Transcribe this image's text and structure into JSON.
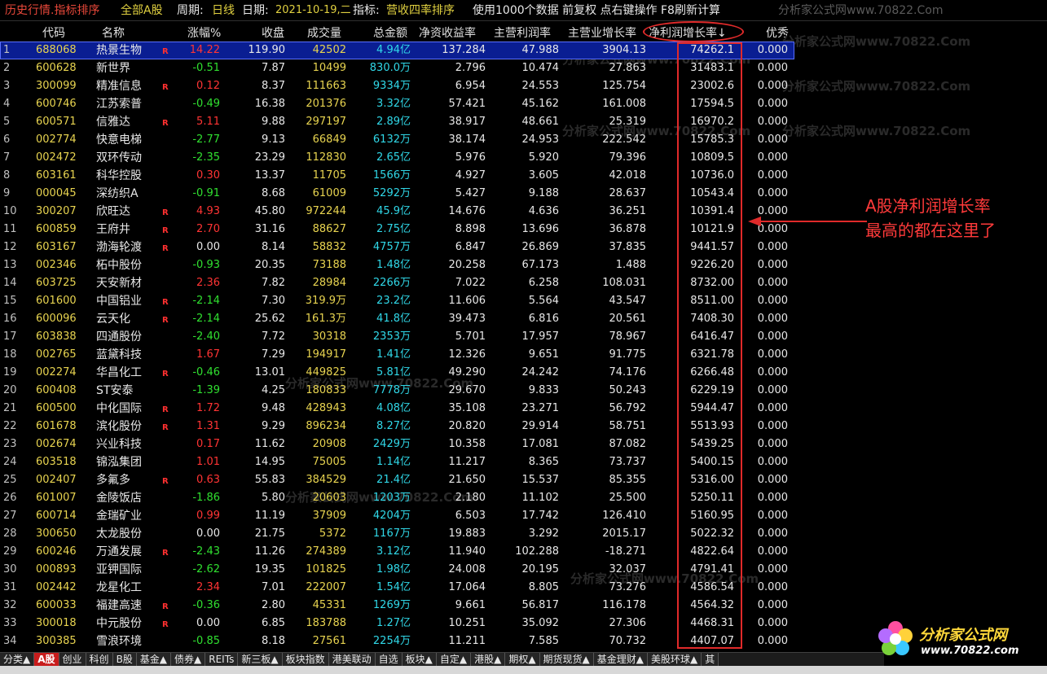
{
  "topbar": {
    "title": "历史行情.指标排序",
    "market": "全部A股",
    "period_label": "周期:",
    "period_value": "日线",
    "date_label": "日期:",
    "date_value": "2021-10-19,二",
    "indicator_label": "指标:",
    "indicator_value": "营收四率排序",
    "info": "使用1000个数据 前复权 点右键操作 F8刷新计算",
    "watermark": "分析家公式网www.70822.Com"
  },
  "columns": [
    "代码",
    "名称",
    "涨幅%",
    "收盘",
    "成交量",
    "总金额",
    "净资收益率",
    "主营利润率",
    "主营业增长率",
    "净利润增长率↓",
    "优秀"
  ],
  "rows": [
    {
      "idx": "1",
      "code": "688068",
      "name": "热景生物",
      "r": "R",
      "pct": "14.22",
      "dir": "up",
      "close": "119.90",
      "vol": "42502",
      "amt": "4.94亿",
      "roe": "137.284",
      "npm": "47.988",
      "rev": "3904.13",
      "npg": "74262.1",
      "exc": "0.000"
    },
    {
      "idx": "2",
      "code": "600628",
      "name": "新世界",
      "r": "",
      "pct": "-0.51",
      "dir": "down",
      "close": "7.87",
      "vol": "10499",
      "amt": "830.0万",
      "roe": "2.796",
      "npm": "10.474",
      "rev": "27.863",
      "npg": "31483.1",
      "exc": "0.000"
    },
    {
      "idx": "3",
      "code": "300099",
      "name": "精准信息",
      "r": "R",
      "pct": "0.12",
      "dir": "up",
      "close": "8.37",
      "vol": "111663",
      "amt": "9334万",
      "roe": "6.954",
      "npm": "24.553",
      "rev": "125.754",
      "npg": "23002.6",
      "exc": "0.000"
    },
    {
      "idx": "4",
      "code": "600746",
      "name": "江苏索普",
      "r": "",
      "pct": "-0.49",
      "dir": "down",
      "close": "16.38",
      "vol": "201376",
      "amt": "3.32亿",
      "roe": "57.421",
      "npm": "45.162",
      "rev": "161.008",
      "npg": "17594.5",
      "exc": "0.000"
    },
    {
      "idx": "5",
      "code": "600571",
      "name": "信雅达",
      "r": "R",
      "pct": "5.11",
      "dir": "up",
      "close": "9.88",
      "vol": "297197",
      "amt": "2.89亿",
      "roe": "38.917",
      "npm": "48.661",
      "rev": "25.319",
      "npg": "16970.2",
      "exc": "0.000"
    },
    {
      "idx": "6",
      "code": "002774",
      "name": "快意电梯",
      "r": "",
      "pct": "-2.77",
      "dir": "down",
      "close": "9.13",
      "vol": "66849",
      "amt": "6132万",
      "roe": "38.174",
      "npm": "24.953",
      "rev": "222.542",
      "npg": "15785.3",
      "exc": "0.000"
    },
    {
      "idx": "7",
      "code": "002472",
      "name": "双环传动",
      "r": "",
      "pct": "-2.35",
      "dir": "down",
      "close": "23.29",
      "vol": "112830",
      "amt": "2.65亿",
      "roe": "5.976",
      "npm": "5.920",
      "rev": "79.396",
      "npg": "10809.5",
      "exc": "0.000"
    },
    {
      "idx": "8",
      "code": "603161",
      "name": "科华控股",
      "r": "",
      "pct": "0.30",
      "dir": "up",
      "close": "13.37",
      "vol": "11705",
      "amt": "1566万",
      "roe": "4.927",
      "npm": "3.605",
      "rev": "42.018",
      "npg": "10736.0",
      "exc": "0.000"
    },
    {
      "idx": "9",
      "code": "000045",
      "name": "深纺织A",
      "r": "",
      "pct": "-0.91",
      "dir": "down",
      "close": "8.68",
      "vol": "61009",
      "amt": "5292万",
      "roe": "5.427",
      "npm": "9.188",
      "rev": "28.637",
      "npg": "10543.4",
      "exc": "0.000"
    },
    {
      "idx": "10",
      "code": "300207",
      "name": "欣旺达",
      "r": "R",
      "pct": "4.93",
      "dir": "up",
      "close": "45.80",
      "vol": "972244",
      "amt": "45.9亿",
      "roe": "14.676",
      "npm": "4.636",
      "rev": "36.251",
      "npg": "10391.4",
      "exc": "0.000"
    },
    {
      "idx": "11",
      "code": "600859",
      "name": "王府井",
      "r": "R",
      "pct": "2.70",
      "dir": "up",
      "close": "31.16",
      "vol": "88627",
      "amt": "2.75亿",
      "roe": "8.898",
      "npm": "13.696",
      "rev": "36.878",
      "npg": "10121.9",
      "exc": "0.000"
    },
    {
      "idx": "12",
      "code": "603167",
      "name": "渤海轮渡",
      "r": "R",
      "pct": "0.00",
      "dir": "flat",
      "close": "8.14",
      "vol": "58832",
      "amt": "4757万",
      "roe": "6.847",
      "npm": "26.869",
      "rev": "37.835",
      "npg": "9441.57",
      "exc": "0.000"
    },
    {
      "idx": "13",
      "code": "002346",
      "name": "柘中股份",
      "r": "",
      "pct": "-0.93",
      "dir": "down",
      "close": "20.35",
      "vol": "73188",
      "amt": "1.48亿",
      "roe": "20.258",
      "npm": "67.173",
      "rev": "1.488",
      "npg": "9226.20",
      "exc": "0.000"
    },
    {
      "idx": "14",
      "code": "603725",
      "name": "天安新材",
      "r": "",
      "pct": "2.36",
      "dir": "up",
      "close": "7.82",
      "vol": "28984",
      "amt": "2266万",
      "roe": "7.022",
      "npm": "6.258",
      "rev": "108.031",
      "npg": "8732.00",
      "exc": "0.000"
    },
    {
      "idx": "15",
      "code": "601600",
      "name": "中国铝业",
      "r": "R",
      "pct": "-2.14",
      "dir": "down",
      "close": "7.30",
      "vol": "319.9万",
      "amt": "23.2亿",
      "roe": "11.606",
      "npm": "5.564",
      "rev": "43.547",
      "npg": "8511.00",
      "exc": "0.000"
    },
    {
      "idx": "16",
      "code": "600096",
      "name": "云天化",
      "r": "R",
      "pct": "-2.14",
      "dir": "down",
      "close": "25.62",
      "vol": "161.3万",
      "amt": "41.8亿",
      "roe": "39.473",
      "npm": "6.816",
      "rev": "20.561",
      "npg": "7408.30",
      "exc": "0.000"
    },
    {
      "idx": "17",
      "code": "603838",
      "name": "四通股份",
      "r": "",
      "pct": "-2.40",
      "dir": "down",
      "close": "7.72",
      "vol": "30318",
      "amt": "2353万",
      "roe": "5.701",
      "npm": "17.957",
      "rev": "78.967",
      "npg": "6416.47",
      "exc": "0.000"
    },
    {
      "idx": "18",
      "code": "002765",
      "name": "蓝黛科技",
      "r": "",
      "pct": "1.67",
      "dir": "up",
      "close": "7.29",
      "vol": "194917",
      "amt": "1.41亿",
      "roe": "12.326",
      "npm": "9.651",
      "rev": "91.775",
      "npg": "6321.78",
      "exc": "0.000"
    },
    {
      "idx": "19",
      "code": "002274",
      "name": "华昌化工",
      "r": "R",
      "pct": "-0.46",
      "dir": "down",
      "close": "13.01",
      "vol": "449825",
      "amt": "5.81亿",
      "roe": "49.290",
      "npm": "24.242",
      "rev": "74.176",
      "npg": "6266.48",
      "exc": "0.000"
    },
    {
      "idx": "20",
      "code": "600408",
      "name": "ST安泰",
      "r": "",
      "pct": "-1.39",
      "dir": "down",
      "close": "4.25",
      "vol": "180833",
      "amt": "7778万",
      "roe": "29.670",
      "npm": "9.833",
      "rev": "50.243",
      "npg": "6229.19",
      "exc": "0.000"
    },
    {
      "idx": "21",
      "code": "600500",
      "name": "中化国际",
      "r": "R",
      "pct": "1.72",
      "dir": "up",
      "close": "9.48",
      "vol": "428943",
      "amt": "4.08亿",
      "roe": "35.108",
      "npm": "23.271",
      "rev": "56.792",
      "npg": "5944.47",
      "exc": "0.000"
    },
    {
      "idx": "22",
      "code": "601678",
      "name": "滨化股份",
      "r": "R",
      "pct": "1.31",
      "dir": "up",
      "close": "9.29",
      "vol": "896234",
      "amt": "8.27亿",
      "roe": "20.820",
      "npm": "29.914",
      "rev": "58.751",
      "npg": "5513.93",
      "exc": "0.000"
    },
    {
      "idx": "23",
      "code": "002674",
      "name": "兴业科技",
      "r": "",
      "pct": "0.17",
      "dir": "up",
      "close": "11.62",
      "vol": "20908",
      "amt": "2429万",
      "roe": "10.358",
      "npm": "17.081",
      "rev": "87.082",
      "npg": "5439.25",
      "exc": "0.000"
    },
    {
      "idx": "24",
      "code": "603518",
      "name": "锦泓集团",
      "r": "",
      "pct": "1.01",
      "dir": "up",
      "close": "14.95",
      "vol": "75005",
      "amt": "1.14亿",
      "roe": "11.217",
      "npm": "8.365",
      "rev": "73.737",
      "npg": "5400.15",
      "exc": "0.000"
    },
    {
      "idx": "25",
      "code": "002407",
      "name": "多氟多",
      "r": "R",
      "pct": "0.63",
      "dir": "up",
      "close": "55.83",
      "vol": "384529",
      "amt": "21.4亿",
      "roe": "21.650",
      "npm": "15.537",
      "rev": "85.355",
      "npg": "5316.00",
      "exc": "0.000"
    },
    {
      "idx": "26",
      "code": "601007",
      "name": "金陵饭店",
      "r": "",
      "pct": "-1.86",
      "dir": "down",
      "close": "5.80",
      "vol": "20603",
      "amt": "1203万",
      "roe": "2.180",
      "npm": "11.102",
      "rev": "25.500",
      "npg": "5250.11",
      "exc": "0.000"
    },
    {
      "idx": "27",
      "code": "600714",
      "name": "金瑞矿业",
      "r": "",
      "pct": "0.99",
      "dir": "up",
      "close": "11.19",
      "vol": "37909",
      "amt": "4204万",
      "roe": "6.503",
      "npm": "17.742",
      "rev": "126.410",
      "npg": "5160.95",
      "exc": "0.000"
    },
    {
      "idx": "28",
      "code": "300650",
      "name": "太龙股份",
      "r": "",
      "pct": "0.00",
      "dir": "flat",
      "close": "21.75",
      "vol": "5372",
      "amt": "1167万",
      "roe": "19.883",
      "npm": "3.292",
      "rev": "2015.17",
      "npg": "5022.32",
      "exc": "0.000"
    },
    {
      "idx": "29",
      "code": "600246",
      "name": "万通发展",
      "r": "R",
      "pct": "-2.43",
      "dir": "down",
      "close": "11.26",
      "vol": "274389",
      "amt": "3.12亿",
      "roe": "11.940",
      "npm": "102.288",
      "rev": "-18.271",
      "npg": "4822.64",
      "exc": "0.000"
    },
    {
      "idx": "30",
      "code": "000893",
      "name": "亚钾国际",
      "r": "",
      "pct": "-2.62",
      "dir": "down",
      "close": "19.35",
      "vol": "101825",
      "amt": "1.98亿",
      "roe": "24.008",
      "npm": "20.195",
      "rev": "32.037",
      "npg": "4791.41",
      "exc": "0.000"
    },
    {
      "idx": "31",
      "code": "002442",
      "name": "龙星化工",
      "r": "",
      "pct": "2.34",
      "dir": "up",
      "close": "7.01",
      "vol": "222007",
      "amt": "1.54亿",
      "roe": "17.064",
      "npm": "8.805",
      "rev": "73.276",
      "npg": "4586.54",
      "exc": "0.000"
    },
    {
      "idx": "32",
      "code": "600033",
      "name": "福建高速",
      "r": "R",
      "pct": "-0.36",
      "dir": "down",
      "close": "2.80",
      "vol": "45331",
      "amt": "1269万",
      "roe": "9.661",
      "npm": "56.817",
      "rev": "116.178",
      "npg": "4564.32",
      "exc": "0.000"
    },
    {
      "idx": "33",
      "code": "300018",
      "name": "中元股份",
      "r": "R",
      "pct": "0.00",
      "dir": "flat",
      "close": "6.85",
      "vol": "183788",
      "amt": "1.27亿",
      "roe": "10.251",
      "npm": "35.092",
      "rev": "27.306",
      "npg": "4468.31",
      "exc": "0.000"
    },
    {
      "idx": "34",
      "code": "300385",
      "name": "雪浪环境",
      "r": "",
      "pct": "-0.85",
      "dir": "down",
      "close": "8.18",
      "vol": "27561",
      "amt": "2254万",
      "roe": "11.211",
      "npm": "7.585",
      "rev": "70.732",
      "npg": "4407.07",
      "exc": "0.000"
    }
  ],
  "annotation": {
    "line1": "A股净利润增长率",
    "line2": "最高的都在这里了"
  },
  "tabs": [
    "分类▲",
    "A股",
    "创业",
    "科创",
    "B股",
    "基金▲",
    "债券▲",
    "REITs",
    "新三板▲",
    "板块指数",
    "港美联动",
    "自选",
    "板块▲",
    "自定▲",
    "港股▲",
    "期权▲",
    "期货现货▲",
    "基金理财▲",
    "美股环球▲",
    "其"
  ],
  "active_tab": "A股",
  "logo": {
    "brand": "分析家公式网",
    "url": "www.70822.com"
  },
  "colors": {
    "up": "#ff3434",
    "down": "#30e030",
    "code": "#e8d450",
    "amount": "#30d8e8",
    "highlight": "#e02a2a",
    "selected_row": "#0a1e92"
  }
}
